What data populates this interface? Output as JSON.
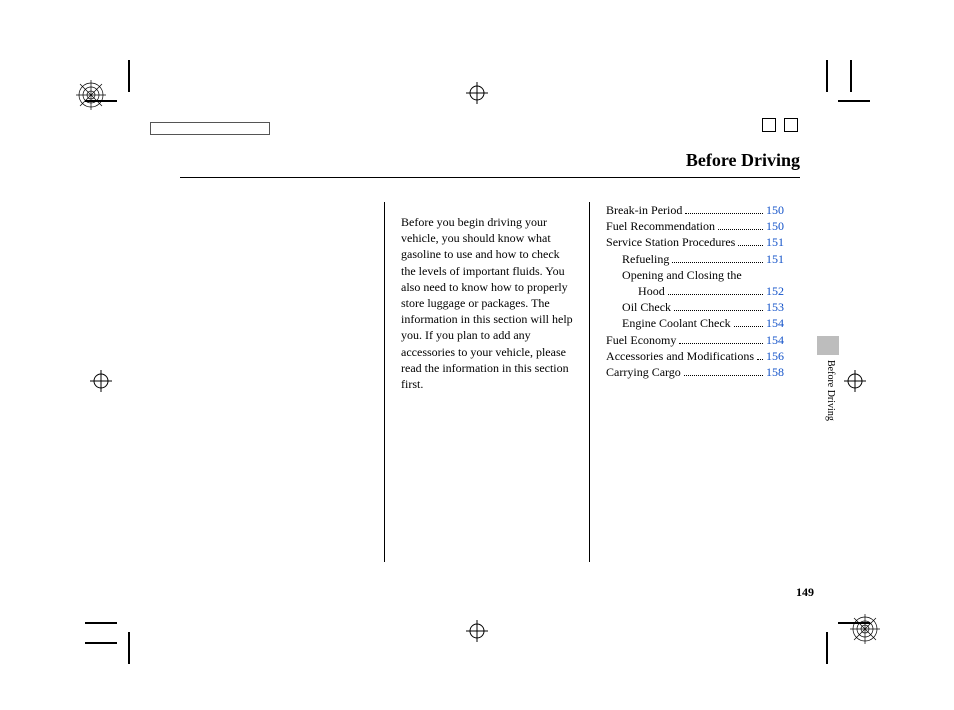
{
  "title": "Before Driving",
  "side_label": "Before Driving",
  "page_number": "149",
  "intro": "Before you begin driving your vehicle, you should know what gasoline to use and how to check the levels of important fluids. You also need to know how to properly store luggage or packages. The information in this section will help you. If you plan to add any accessories to your vehicle, please read the information in this section first.",
  "toc": [
    {
      "label": "Break-in Period",
      "page": "150",
      "indent": 0
    },
    {
      "label": "Fuel Recommendation",
      "page": "150",
      "indent": 0
    },
    {
      "label": "Service Station Procedures",
      "page": "151",
      "indent": 0
    },
    {
      "label": "Refueling",
      "page": "151",
      "indent": 1
    },
    {
      "label": "Opening and Closing the",
      "page": "",
      "indent": 1,
      "nodots": true
    },
    {
      "label": "Hood",
      "page": "152",
      "indent": 2
    },
    {
      "label": "Oil Check",
      "page": "153",
      "indent": 1
    },
    {
      "label": "Engine Coolant Check",
      "page": "154",
      "indent": 1
    },
    {
      "label": "Fuel Economy",
      "page": "154",
      "indent": 0
    },
    {
      "label": "Accessories and Modifications",
      "page": "156",
      "indent": 0
    },
    {
      "label": "Carrying Cargo",
      "page": "158",
      "indent": 0
    }
  ]
}
